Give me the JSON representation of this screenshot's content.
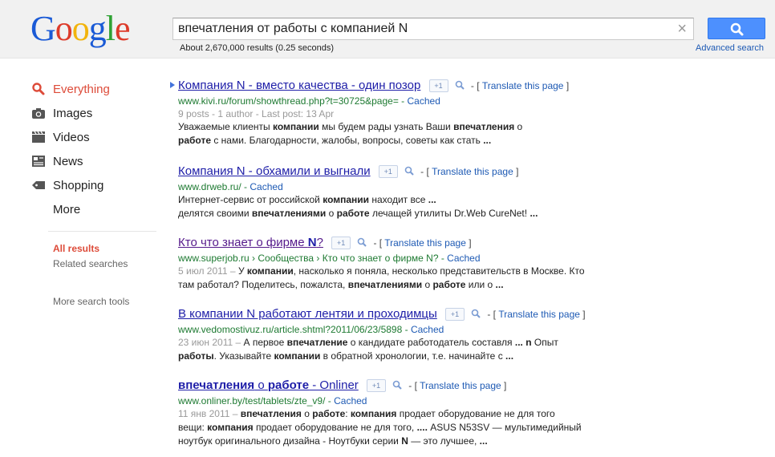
{
  "header": {
    "logo": "Google",
    "logo_colors": [
      "#1a5ad6",
      "#dd3b2a",
      "#f2b40d",
      "#1a5ad6",
      "#2fa233",
      "#dd3b2a"
    ],
    "query": "впечатления от работы с компанией N",
    "clear_label": "×",
    "stats": "About 2,670,000 results (0.25 seconds)",
    "advanced_search": "Advanced search",
    "button_color": "#4d90fe"
  },
  "nav": {
    "items": [
      {
        "label": "Everything",
        "icon": "search-icon",
        "active": true
      },
      {
        "label": "Images",
        "icon": "camera-icon",
        "active": false
      },
      {
        "label": "Videos",
        "icon": "film-icon",
        "active": false
      },
      {
        "label": "News",
        "icon": "newspaper-icon",
        "active": false
      },
      {
        "label": "Shopping",
        "icon": "price-tag-icon",
        "active": false
      },
      {
        "label": "More",
        "icon": "",
        "active": false
      }
    ],
    "all_results": "All results",
    "related_searches": "Related searches",
    "more_tools": "More search tools"
  },
  "results": [
    {
      "title": "Компания N - вместо качества - один позор",
      "url": "www.kivi.ru/forum/showthread.php?t=30725&page=",
      "cached": "Cached",
      "meta": "9 posts - 1 author - Last post: 13 Apr",
      "translate": "Translate this page",
      "snippet_lines": [
        [
          [
            "Уважаемые клиенты ",
            false
          ],
          [
            "компании",
            true
          ],
          [
            "  мы будем рады узнать Ваши ",
            false
          ],
          [
            "впечатления",
            true
          ],
          [
            " о",
            false
          ]
        ],
        [
          [
            "работе",
            true
          ],
          [
            " с нами. Благодарности, жалобы, вопросы, советы как стать ",
            false
          ],
          [
            "...",
            true
          ]
        ]
      ]
    },
    {
      "title": "Компания N - обхамили и выгнали",
      "url": "www.drweb.ru/",
      "cached": "Cached",
      "translate": "Translate this page",
      "snippet_lines": [
        [
          [
            "Интернет-сервис от российской ",
            false
          ],
          [
            "компании",
            true
          ],
          [
            " находит все ",
            false
          ],
          [
            "...",
            true
          ]
        ],
        [
          [
            "делятся своими ",
            false
          ],
          [
            "впечатлениями",
            true
          ],
          [
            " о ",
            false
          ],
          [
            "работе",
            true
          ],
          [
            " лечащей утилиты Dr.Web CureNet! ",
            false
          ],
          [
            "...",
            true
          ]
        ]
      ]
    },
    {
      "title_parts": [
        [
          "Кто что знает о фирме ",
          false
        ],
        [
          "N",
          true
        ],
        [
          "?",
          false
        ]
      ],
      "url": "www.superjob.ru › Сообщества › Кто что знает о фирме N?",
      "cached": "Cached",
      "translate": "Translate this page",
      "date": "5 июл 2011",
      "snippet_lines": [
        [
          [
            "У ",
            false
          ],
          [
            "компании",
            true
          ],
          [
            ", насколько я поняла, несколько представительств в Москве. Кто",
            false
          ]
        ],
        [
          [
            "там работал? Поделитесь, пожалста, ",
            false
          ],
          [
            "впечатлениями",
            true
          ],
          [
            " о ",
            false
          ],
          [
            "работе",
            true
          ],
          [
            " или о ",
            false
          ],
          [
            "...",
            true
          ]
        ]
      ]
    },
    {
      "title": "В компании N работают лентяи и проходимцы",
      "url": "www.vedomostivuz.ru/article.shtml?2011/06/23/5898",
      "cached": "Cached",
      "translate": "Translate this page",
      "date": "23 июн 2011",
      "snippet_lines": [
        [
          [
            "А первое ",
            false
          ],
          [
            "впечатление",
            true
          ],
          [
            " о кандидате работодатель составля ",
            false
          ],
          [
            "...",
            true
          ],
          [
            " ",
            false
          ],
          [
            "n",
            true
          ],
          [
            " Опыт",
            false
          ]
        ],
        [
          [
            "работы",
            true
          ],
          [
            ". Указывайте ",
            false
          ],
          [
            "компании",
            true
          ],
          [
            " в обратной хронологии, т.е. начинайте с ",
            false
          ],
          [
            "...",
            true
          ]
        ]
      ]
    },
    {
      "title_parts": [
        [
          "впечатления",
          true
        ],
        [
          " о ",
          false
        ],
        [
          "работе",
          true
        ],
        [
          " - Onliner",
          false
        ]
      ],
      "url": "www.onliner.by/test/tablets/zte_v9/",
      "cached": "Cached",
      "translate": "Translate this page",
      "date": "11 янв 2011",
      "snippet_lines": [
        [
          [
            "впечатления",
            true
          ],
          [
            " о ",
            false
          ],
          [
            "работе",
            true
          ],
          [
            ": ",
            false
          ],
          [
            "компания",
            true
          ],
          [
            " продает оборудование не для того",
            false
          ]
        ],
        [
          [
            "вещи: ",
            false
          ],
          [
            "компания",
            true
          ],
          [
            " продает оборудование не для того, ",
            false
          ],
          [
            "....",
            true
          ],
          [
            " ASUS N53SV — мультимедийный",
            false
          ]
        ],
        [
          [
            "ноутбук оригинального дизайна - Ноутбуки серии ",
            false
          ],
          [
            "N",
            true
          ],
          [
            " — это лучшее, ",
            false
          ],
          [
            "...",
            true
          ]
        ]
      ]
    }
  ]
}
